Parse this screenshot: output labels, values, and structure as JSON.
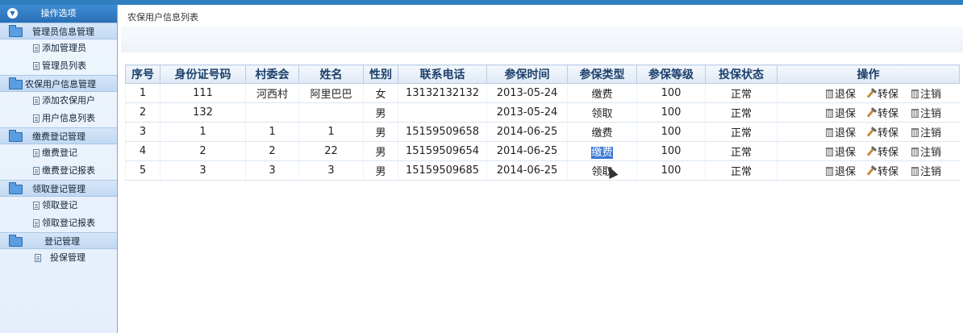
{
  "sidebar": {
    "header": "操作选项",
    "groups": [
      {
        "title": "管理员信息管理",
        "items": [
          "添加管理员",
          "管理员列表"
        ]
      },
      {
        "title": "农保用户信息管理",
        "items": [
          "添加农保用户",
          "用户信息列表"
        ]
      },
      {
        "title": "缴费登记管理",
        "items": [
          "缴费登记",
          "缴费登记报表"
        ]
      },
      {
        "title": "领取登记管理",
        "items": [
          "领取登记",
          "领取登记报表"
        ]
      },
      {
        "title": "登记管理",
        "items": [
          "投保管理"
        ]
      }
    ]
  },
  "main": {
    "breadcrumb": "农保用户信息列表",
    "table": {
      "headers": [
        "序号",
        "身份证号码",
        "村委会",
        "姓名",
        "性别",
        "联系电话",
        "参保时间",
        "参保类型",
        "参保等级",
        "投保状态",
        "操作"
      ],
      "rows": [
        [
          "1",
          "111",
          "河西村",
          "阿里巴巴",
          "女",
          "13132132132",
          "2013-05-24",
          "缴费",
          "100",
          "正常"
        ],
        [
          "2",
          "132",
          "",
          "",
          "男",
          "",
          "2013-05-24",
          "领取",
          "100",
          "正常"
        ],
        [
          "3",
          "1",
          "1",
          "1",
          "男",
          "15159509658",
          "2014-06-25",
          "缴费",
          "100",
          "正常"
        ],
        [
          "4",
          "2",
          "2",
          "22",
          "男",
          "15159509654",
          "2014-06-25",
          "缴费",
          "100",
          "正常"
        ],
        [
          "5",
          "3",
          "3",
          "3",
          "男",
          "15159509685",
          "2014-06-25",
          "领取",
          "100",
          "正常"
        ]
      ],
      "actions": [
        "退保",
        "转保",
        "注销"
      ]
    }
  },
  "colors": {
    "accent": "#2f7ec0",
    "selection": "#3b78d6"
  },
  "icons": {
    "actions": [
      "trash-icon",
      "hammer-icon",
      "trash-icon"
    ]
  }
}
